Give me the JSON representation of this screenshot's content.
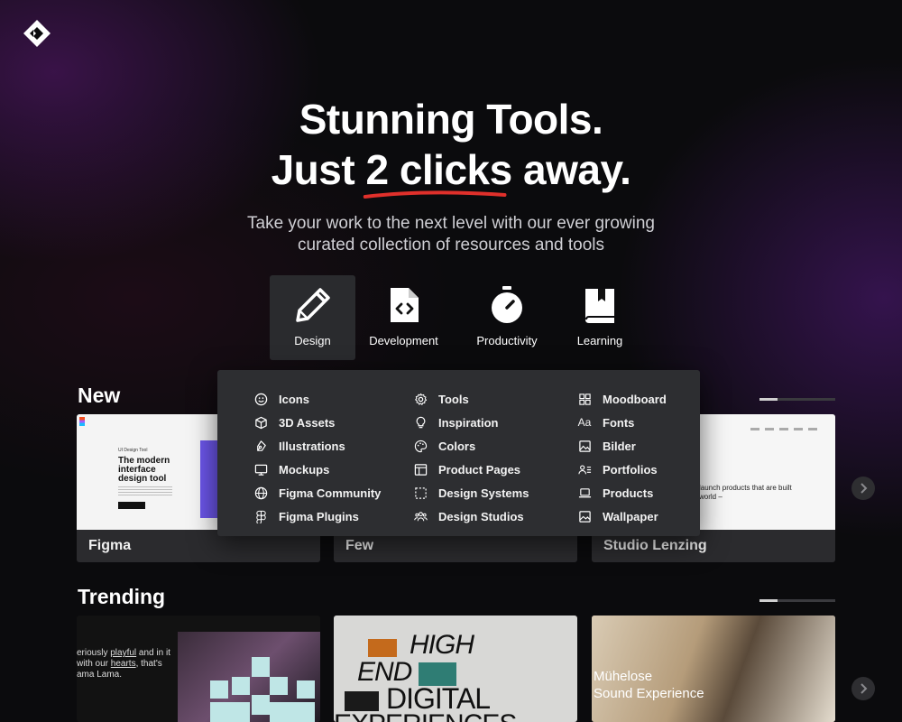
{
  "hero": {
    "title_line1": "Stunning Tools.",
    "title_line2_a": "Just ",
    "title_line2_b": "2 clicks",
    "title_line2_c": " away.",
    "subtitle": "Take your work to the next level with our ever growing curated collection of resources and tools",
    "underline_color": "#e0302b"
  },
  "categories": [
    {
      "label": "Design",
      "icon": "pencil-icon",
      "active": true
    },
    {
      "label": "Development",
      "icon": "code-file-icon",
      "active": false
    },
    {
      "label": "Productivity",
      "icon": "stopwatch-icon",
      "active": false
    },
    {
      "label": "Learning",
      "icon": "book-icon",
      "active": false
    }
  ],
  "dropdown": {
    "col1": [
      "Icons",
      "3D Assets",
      "Illustrations",
      "Mockups",
      "Figma Community",
      "Figma Plugins"
    ],
    "col2": [
      "Tools",
      "Inspiration",
      "Colors",
      "Product Pages",
      "Design Systems",
      "Design Studios"
    ],
    "col3": [
      "Moodboard",
      "Fonts",
      "Bilder",
      "Portfolios",
      "Products",
      "Wallpaper"
    ]
  },
  "sections": {
    "new": {
      "title": "New",
      "cards": [
        "Figma",
        "Few",
        "Studio Lenzing"
      ],
      "pager_progress": 0.25
    },
    "trending": {
      "title": "Trending",
      "pager_progress": 0.25
    }
  },
  "thumbs": {
    "figma_tag": "UI Design Tool",
    "figma_heading": "The modern interface design tool",
    "lenzing_text": "launch products that are built world –",
    "trend1_text_a": "eriously ",
    "trend1_text_b": "playful",
    "trend1_text_c": " and in it with our ",
    "trend1_text_d": "hearts",
    "trend1_text_e": ", that's ama Lama.",
    "trend2_line1": "HIGH",
    "trend2_line2": "END",
    "trend2_line3": "DIGITAL",
    "trend2_line4": "EXPERIENCES",
    "trend3_line1": "Mühelose",
    "trend3_line2": "Sound Experience"
  },
  "colors": {
    "background": "#0b0b0d",
    "panel": "#2d2e31",
    "accent_red": "#e0302b"
  }
}
